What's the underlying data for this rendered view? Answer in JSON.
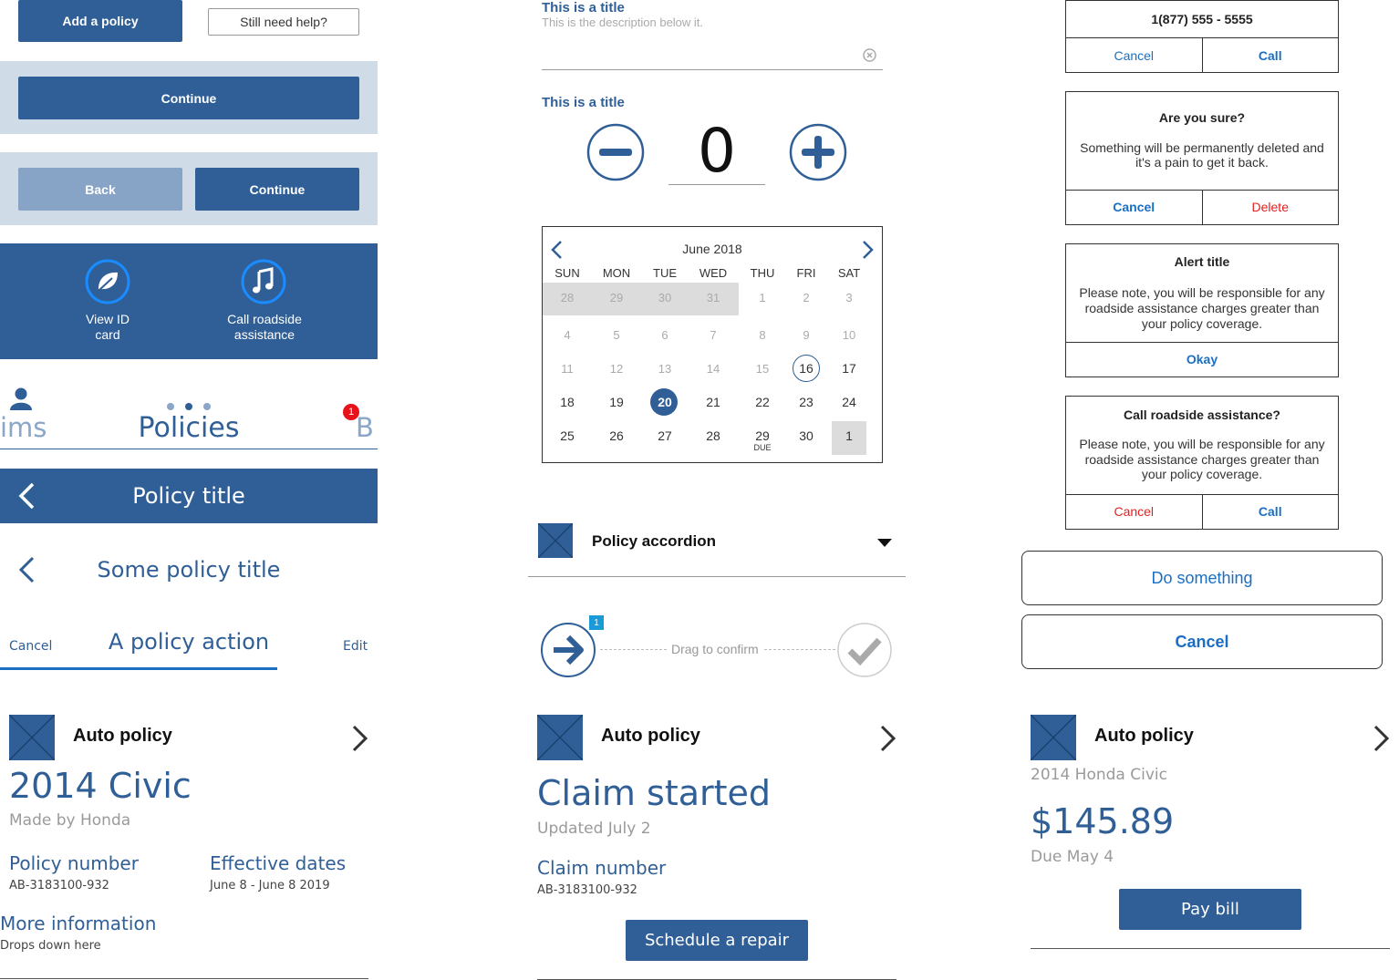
{
  "col1": {
    "add_policy": "Add a policy",
    "still_help": "Still need help?",
    "continue1": "Continue",
    "back": "Back",
    "continue2": "Continue",
    "quick_actions": [
      {
        "label_line1": "View ID",
        "label_line2": "card",
        "icon": "leaf-icon"
      },
      {
        "label_line1": "Call roadside",
        "label_line2": "assistance",
        "icon": "music-note-icon"
      }
    ],
    "tabs": {
      "left": "ims",
      "center": "Policies",
      "right": "B",
      "badge": "1"
    },
    "header_title": "Policy title",
    "sub_header_title": "Some policy title",
    "action_bar": {
      "cancel": "Cancel",
      "title": "A policy action",
      "edit": "Edit"
    },
    "card": {
      "heading": "Auto policy",
      "vehicle": "2014 Civic",
      "maker": "Made by Honda",
      "policy_number_label": "Policy number",
      "policy_number": "AB-3183100-932",
      "effective_label": "Effective dates",
      "effective": "June 8 - June 8 2019",
      "more_info": "More information",
      "more_info_sub": "Drops down here"
    }
  },
  "col2": {
    "field": {
      "title": "This is a title",
      "description": "This is the description below it."
    },
    "stepper": {
      "title": "This is a title",
      "value": "0"
    },
    "calendar": {
      "month": "June 2018",
      "weekdays": [
        "SUN",
        "MON",
        "TUE",
        "WED",
        "THU",
        "FRI",
        "SAT"
      ],
      "weeks": [
        [
          "28",
          "29",
          "30",
          "31",
          "1",
          "2",
          "3"
        ],
        [
          "4",
          "5",
          "6",
          "7",
          "8",
          "9",
          "10"
        ],
        [
          "11",
          "12",
          "13",
          "14",
          "15",
          "16",
          "17"
        ],
        [
          "18",
          "19",
          "20",
          "21",
          "22",
          "23",
          "24"
        ],
        [
          "25",
          "26",
          "27",
          "28",
          "29",
          "30",
          "1"
        ]
      ],
      "due_label": "DUE"
    },
    "accordion": "Policy accordion",
    "drag": {
      "label": "Drag to confirm",
      "badge": "1"
    },
    "card": {
      "heading": "Auto policy",
      "status": "Claim started",
      "updated": "Updated July 2",
      "claim_label": "Claim number",
      "claim_number": "AB-3183100-932",
      "button": "Schedule a repair"
    }
  },
  "col3": {
    "call_alert": {
      "phone": "1(877) 555 - 5555",
      "cancel": "Cancel",
      "call": "Call"
    },
    "sure_alert": {
      "title": "Are you sure?",
      "body": "Something will be permanently deleted and it's a pain to get it back.",
      "cancel": "Cancel",
      "delete": "Delete"
    },
    "note_alert": {
      "title": "Alert title",
      "body": "Please note, you will be responsible for any roadside assistance charges greater than your policy coverage.",
      "okay": "Okay"
    },
    "roadside_alert": {
      "title": "Call roadside assistance?",
      "body": "Please note, you will be responsible for any roadside assistance charges greater than your policy coverage.",
      "cancel": "Cancel",
      "call": "Call"
    },
    "sheet": {
      "action": "Do something",
      "cancel": "Cancel"
    },
    "card": {
      "heading": "Auto policy",
      "vehicle": "2014 Honda Civic",
      "amount": "$145.89",
      "due": "Due May 4",
      "button": "Pay bill"
    }
  },
  "colors": {
    "brand_blue": "#2f5f96",
    "link_blue": "#1a6fc4",
    "alert_red": "#e02020",
    "badge_red": "#e8121b"
  }
}
